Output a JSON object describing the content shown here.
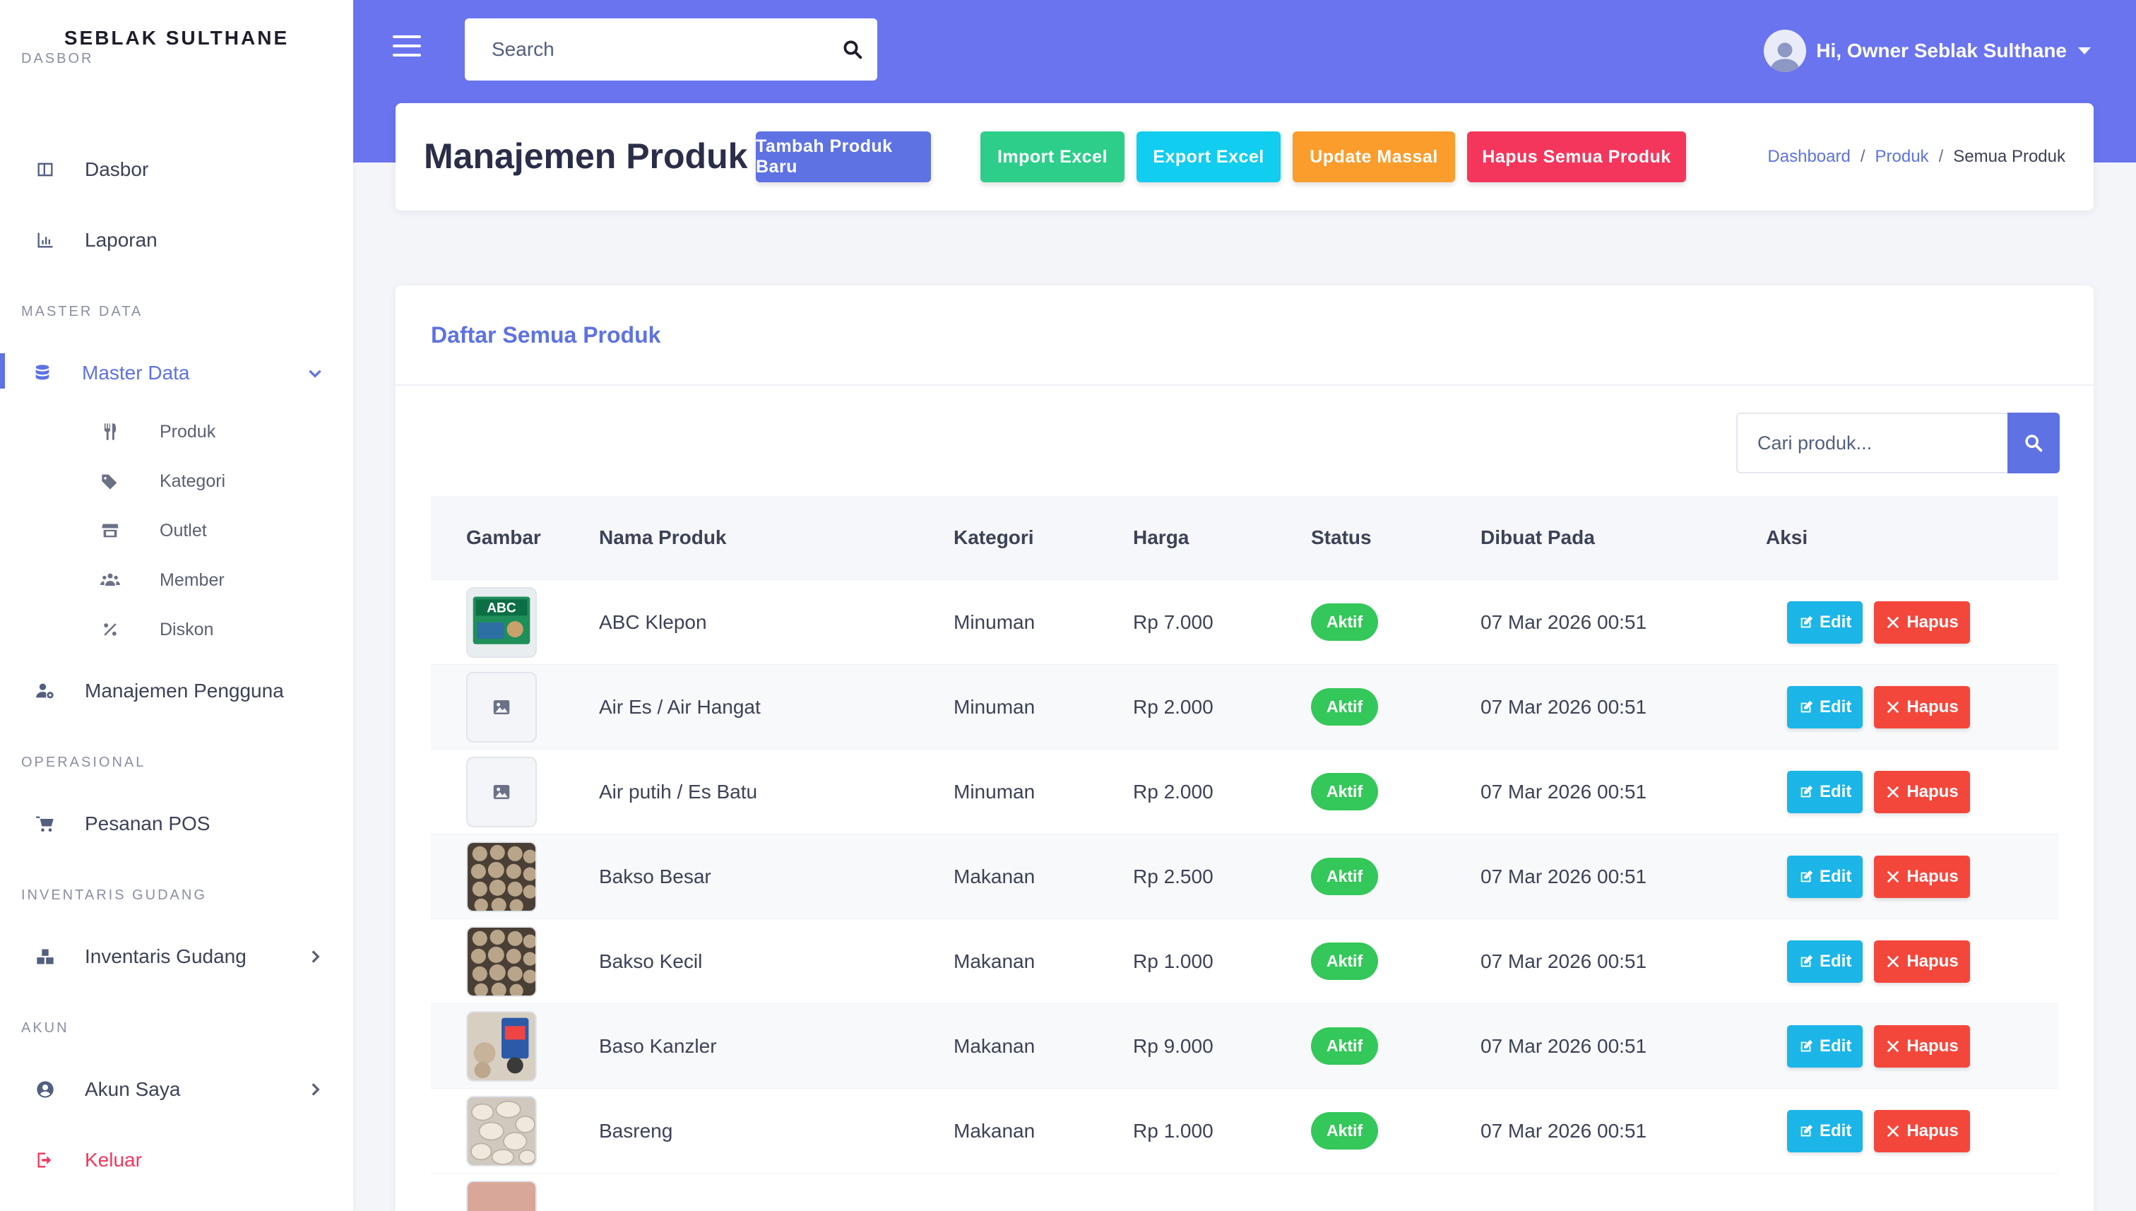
{
  "sidebar": {
    "brand": "SEBLAK SULTHANE",
    "sections": {
      "dasbor": "DASBOR",
      "master": "MASTER DATA",
      "operasional": "OPERASIONAL",
      "inventaris": "INVENTARIS GUDANG",
      "akun": "AKUN"
    },
    "items": {
      "dasbor": "Dasbor",
      "laporan": "Laporan",
      "master_data": "Master Data",
      "produk": "Produk",
      "kategori": "Kategori",
      "outlet": "Outlet",
      "member": "Member",
      "diskon": "Diskon",
      "manajemen_pengguna": "Manajemen Pengguna",
      "pesanan_pos": "Pesanan POS",
      "inventaris_gudang": "Inventaris Gudang",
      "akun_saya": "Akun Saya",
      "keluar": "Keluar"
    }
  },
  "topbar": {
    "search_placeholder": "Search",
    "user_greeting": "Hi, Owner Seblak Sulthane"
  },
  "page": {
    "title": "Manajemen Produk",
    "actions": {
      "tambah": "Tambah Produk Baru",
      "import": "Import Excel",
      "export": "Export Excel",
      "update": "Update Massal",
      "hapus_semua": "Hapus Semua Produk"
    },
    "breadcrumb": {
      "dashboard": "Dashboard",
      "produk": "Produk",
      "current": "Semua Produk",
      "separator": "/"
    }
  },
  "list": {
    "heading": "Daftar Semua Produk",
    "search_placeholder": "Cari produk...",
    "columns": [
      "Gambar",
      "Nama Produk",
      "Kategori",
      "Harga",
      "Status",
      "Dibuat Pada",
      "Aksi"
    ],
    "edit_label": "Edit",
    "delete_label": "Hapus",
    "rows": [
      {
        "name": "ABC Klepon",
        "category": "Minuman",
        "price": "Rp 7.000",
        "status": "Aktif",
        "created": "07 Mar 2026 00:51",
        "image": "abc-photo"
      },
      {
        "name": "Air Es / Air Hangat",
        "category": "Minuman",
        "price": "Rp 2.000",
        "status": "Aktif",
        "created": "07 Mar 2026 00:51",
        "image": "placeholder-icon"
      },
      {
        "name": "Air putih / Es Batu",
        "category": "Minuman",
        "price": "Rp 2.000",
        "status": "Aktif",
        "created": "07 Mar 2026 00:51",
        "image": "placeholder-icon"
      },
      {
        "name": "Bakso Besar",
        "category": "Makanan",
        "price": "Rp 2.500",
        "status": "Aktif",
        "created": "07 Mar 2026 00:51",
        "image": "bakso-photo"
      },
      {
        "name": "Bakso Kecil",
        "category": "Makanan",
        "price": "Rp 1.000",
        "status": "Aktif",
        "created": "07 Mar 2026 00:51",
        "image": "bakso-photo"
      },
      {
        "name": "Baso Kanzler",
        "category": "Makanan",
        "price": "Rp 9.000",
        "status": "Aktif",
        "created": "07 Mar 2026 00:51",
        "image": "kanzler-photo"
      },
      {
        "name": "Basreng",
        "category": "Makanan",
        "price": "Rp 1.000",
        "status": "Aktif",
        "created": "07 Mar 2026 00:51",
        "image": "basreng-photo"
      }
    ]
  },
  "colors": {
    "accent": "#5e72e4",
    "header_band": "#6a74ef",
    "btn_tambah": "#5e72e4",
    "btn_import": "#2dce89",
    "btn_export": "#11cdef",
    "btn_update": "#fb9d2c",
    "btn_hapus": "#f5365c",
    "status_active": "#34c759"
  }
}
